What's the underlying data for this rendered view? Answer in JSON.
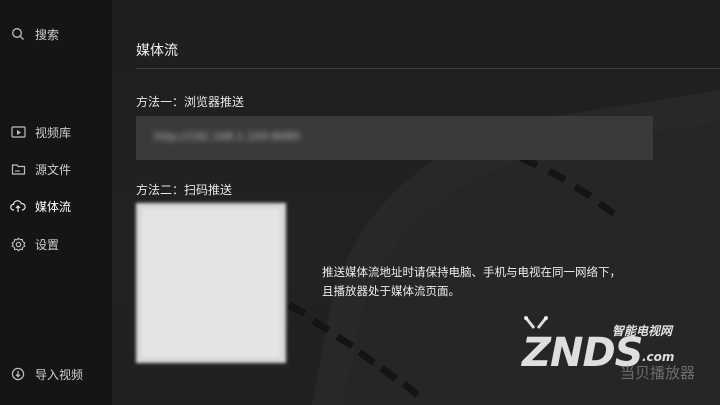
{
  "sidebar": {
    "items": [
      {
        "label": "搜索",
        "icon": "search-icon"
      },
      {
        "label": "视频库",
        "icon": "video-library-icon"
      },
      {
        "label": "源文件",
        "icon": "folder-icon"
      },
      {
        "label": "媒体流",
        "icon": "cloud-upload-icon",
        "active": true
      },
      {
        "label": "设置",
        "icon": "gear-icon"
      },
      {
        "label": "导入视频",
        "icon": "import-icon"
      }
    ]
  },
  "main": {
    "title": "媒体流",
    "method1_label": "方法一：浏览器推送",
    "method1_url": "http://192.168.1.100:8080",
    "method2_label": "方法二：扫码推送",
    "hint_line1": "推送媒体流地址时请保持电脑、手机与电视在同一网络下，",
    "hint_line2": "且播放器处于媒体流页面。"
  },
  "watermark": {
    "sub": "智能电视网",
    "main": "ZNDS",
    "dotcom": ".com",
    "app": "当贝播放器"
  }
}
